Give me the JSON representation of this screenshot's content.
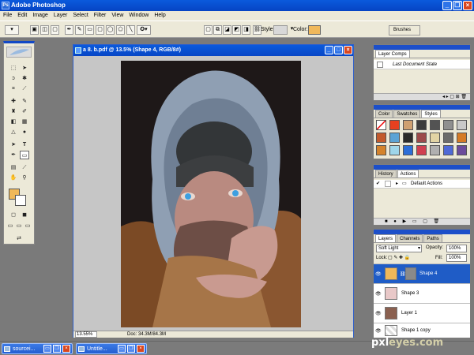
{
  "app": {
    "title": "Adobe Photoshop"
  },
  "menubar": [
    "File",
    "Edit",
    "Image",
    "Layer",
    "Select",
    "Filter",
    "View",
    "Window",
    "Help"
  ],
  "options": {
    "style_label": "Style:",
    "color_label": "Color:",
    "color_value": "#f0b85a",
    "brushes_tab": "Brushes"
  },
  "document": {
    "title": "a 8. b.pdf @ 13.5% (Shape 4, RGB/8#)",
    "zoom": "13.55%",
    "doc_info": "Doc: 34.3M/84.3M"
  },
  "toolbox": {
    "fg_color": "#f1b95a",
    "bg_color": "#ffffff"
  },
  "layer_comps": {
    "tab": "Layer Comps",
    "items": [
      "Last Document State"
    ]
  },
  "color_panel": {
    "tabs": [
      "Color",
      "Swatches",
      "Styles"
    ],
    "style_colors": [
      "#ffffff",
      "#e74020",
      "#cfa070",
      "#3c3c3c",
      "#535353",
      "#8f8f8f",
      "#c9c9c9",
      "#c35b2d",
      "#5ca3d5",
      "#2b2b2b",
      "#9c4a4a",
      "#e2d4a4",
      "#6b6b6b",
      "#d57a25",
      "#d4832c",
      "#9fd6ea",
      "#2c6ed8",
      "#d04050",
      "#b0b0b0",
      "#4f6ad6",
      "#6c4c9c"
    ]
  },
  "history_panel": {
    "tabs": [
      "History",
      "Actions"
    ],
    "items": [
      "Default Actions"
    ]
  },
  "layers_panel": {
    "tabs": [
      "Layers",
      "Channels",
      "Paths"
    ],
    "blend_mode": "Soft Light",
    "opacity_label": "Opacity:",
    "opacity_value": "100%",
    "lock_label": "Lock:",
    "fill_label": "Fill:",
    "fill_value": "100%",
    "layers": [
      {
        "name": "Shape 4",
        "selected": true
      },
      {
        "name": "Shape 3",
        "selected": false
      },
      {
        "name": "Layer 1",
        "selected": false
      },
      {
        "name": "Shape 1 copy",
        "selected": false
      }
    ]
  },
  "taskbar": {
    "items": [
      "sourcei...",
      "Untitle..."
    ]
  },
  "watermark": {
    "text_a": "pxl",
    "text_b": "eyes.com"
  }
}
